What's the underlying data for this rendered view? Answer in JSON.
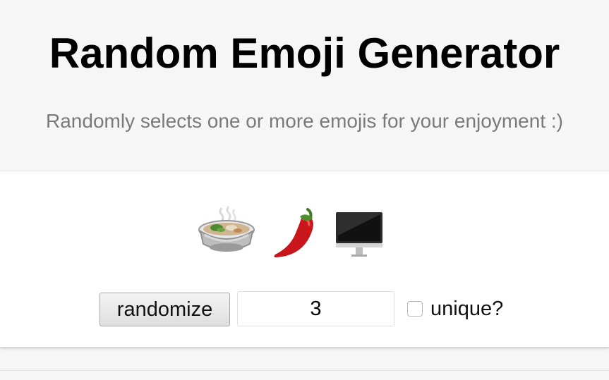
{
  "header": {
    "title": "Random Emoji Generator",
    "subtitle": "Randomly selects one or more emojis for your enjoyment :)"
  },
  "emojis": [
    {
      "name": "stew-bowl-icon",
      "char": "🍲"
    },
    {
      "name": "hot-pepper-icon",
      "char": "🌶️"
    },
    {
      "name": "desktop-computer-icon",
      "char": "🖥️"
    }
  ],
  "controls": {
    "randomize_label": "randomize",
    "count_value": "3",
    "unique_label": "unique?",
    "unique_checked": false
  }
}
